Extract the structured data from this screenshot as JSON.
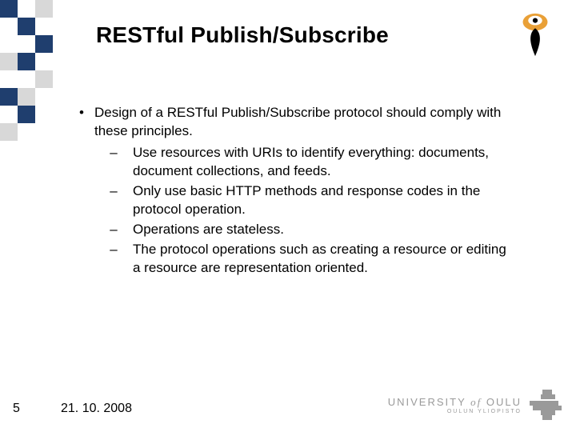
{
  "title": "RESTful Publish/Subscribe",
  "body": {
    "intro": "Design of a RESTful Publish/Subscribe protocol should comply with these principles.",
    "subs": [
      "Use resources with URIs to identify everything: documents, document collections, and feeds.",
      "Only use basic HTTP methods and response codes in the protocol operation.",
      "Operations are stateless.",
      " The protocol operations such as creating a resource or editing a resource are representation oriented."
    ]
  },
  "footer": {
    "page_number": "5",
    "date": "21. 10. 2008"
  },
  "branding": {
    "university_main": "UNIVERSITY of OULU",
    "university_sub": "OULUN YLIOPISTO"
  },
  "icons": {
    "torch": "torch-icon",
    "cross": "pixel-cross-icon"
  }
}
